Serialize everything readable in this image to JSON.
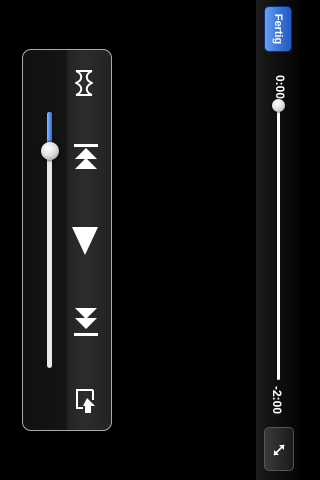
{
  "topbar": {
    "done_label": "Fertig",
    "elapsed_time": "0:00",
    "remaining_time": "-2:00",
    "playback_progress": 0
  },
  "controls": {
    "volume_level": 0.13,
    "icons": [
      "chapters-icon",
      "skip-back-icon",
      "play-icon",
      "skip-forward-icon",
      "airplay-icon",
      "fullscreen-toggle-icon"
    ]
  },
  "colors": {
    "accent": "#3c78d9",
    "volume_fill": "#2d6ee0",
    "background": "#000000"
  }
}
